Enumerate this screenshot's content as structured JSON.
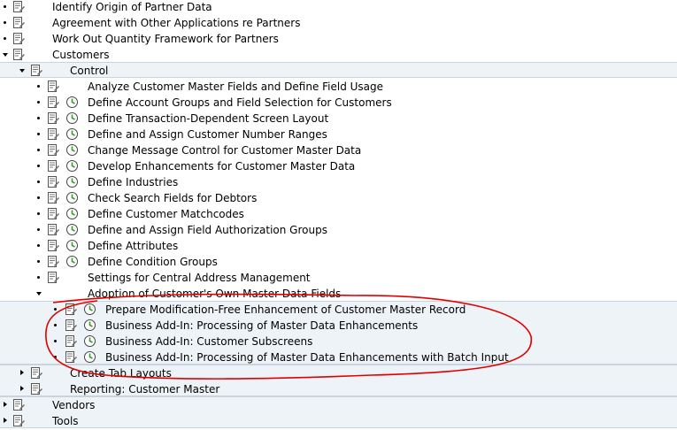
{
  "tree": {
    "level0_top": [
      {
        "label": "Identify Origin of Partner Data",
        "toggle": "bullet"
      },
      {
        "label": "Agreement with Other Applications re Partners",
        "toggle": "bullet"
      },
      {
        "label": "Work Out Quantity Framework for Partners",
        "toggle": "bullet"
      },
      {
        "label": "Customers",
        "toggle": "expanded"
      }
    ],
    "control": {
      "label": "Control",
      "toggle": "expanded"
    },
    "control_items": [
      {
        "label": "Analyze Customer Master Fields and Define Field Usage",
        "has_clock": false
      },
      {
        "label": "Define Account Groups and Field Selection for Customers",
        "has_clock": true
      },
      {
        "label": "Define Transaction-Dependent Screen Layout",
        "has_clock": true
      },
      {
        "label": "Define and Assign Customer Number Ranges",
        "has_clock": true
      },
      {
        "label": "Change Message Control for Customer Master Data",
        "has_clock": true
      },
      {
        "label": "Develop Enhancements for Customer Master Data",
        "has_clock": true
      },
      {
        "label": "Define Industries",
        "has_clock": true
      },
      {
        "label": "Check Search Fields for Debtors",
        "has_clock": true
      },
      {
        "label": "Define Customer Matchcodes",
        "has_clock": true
      },
      {
        "label": "Define and Assign Field Authorization Groups",
        "has_clock": true
      },
      {
        "label": "Define Attributes",
        "has_clock": true
      },
      {
        "label": "Define Condition Groups",
        "has_clock": true
      },
      {
        "label": "Settings for Central Address Management",
        "has_clock": false
      }
    ],
    "adoption": {
      "label": "Adoption of Customer's Own Master Data Fields",
      "toggle": "expanded"
    },
    "adoption_items": [
      {
        "label": "Prepare Modification-Free Enhancement of Customer Master Record"
      },
      {
        "label": "Business Add-In: Processing of Master Data Enhancements"
      },
      {
        "label": "Business Add-In: Customer Subscreens"
      },
      {
        "label": "Business Add-In: Processing of Master Data Enhancements with Batch Input"
      }
    ],
    "customers_after": [
      {
        "label": "Create Tab Layouts",
        "toggle": "collapsed"
      },
      {
        "label": "Reporting: Customer Master",
        "toggle": "collapsed"
      }
    ],
    "level0_bottom": [
      {
        "label": "Vendors",
        "toggle": "collapsed"
      },
      {
        "label": "Tools",
        "toggle": "collapsed"
      }
    ]
  },
  "colors": {
    "band_bg": "#eef3f8",
    "annotation": "#e00000",
    "clock_green": "#3a9a2a"
  },
  "icons": {
    "doc": "document-pencil-icon",
    "clock": "execute-clock-icon"
  }
}
